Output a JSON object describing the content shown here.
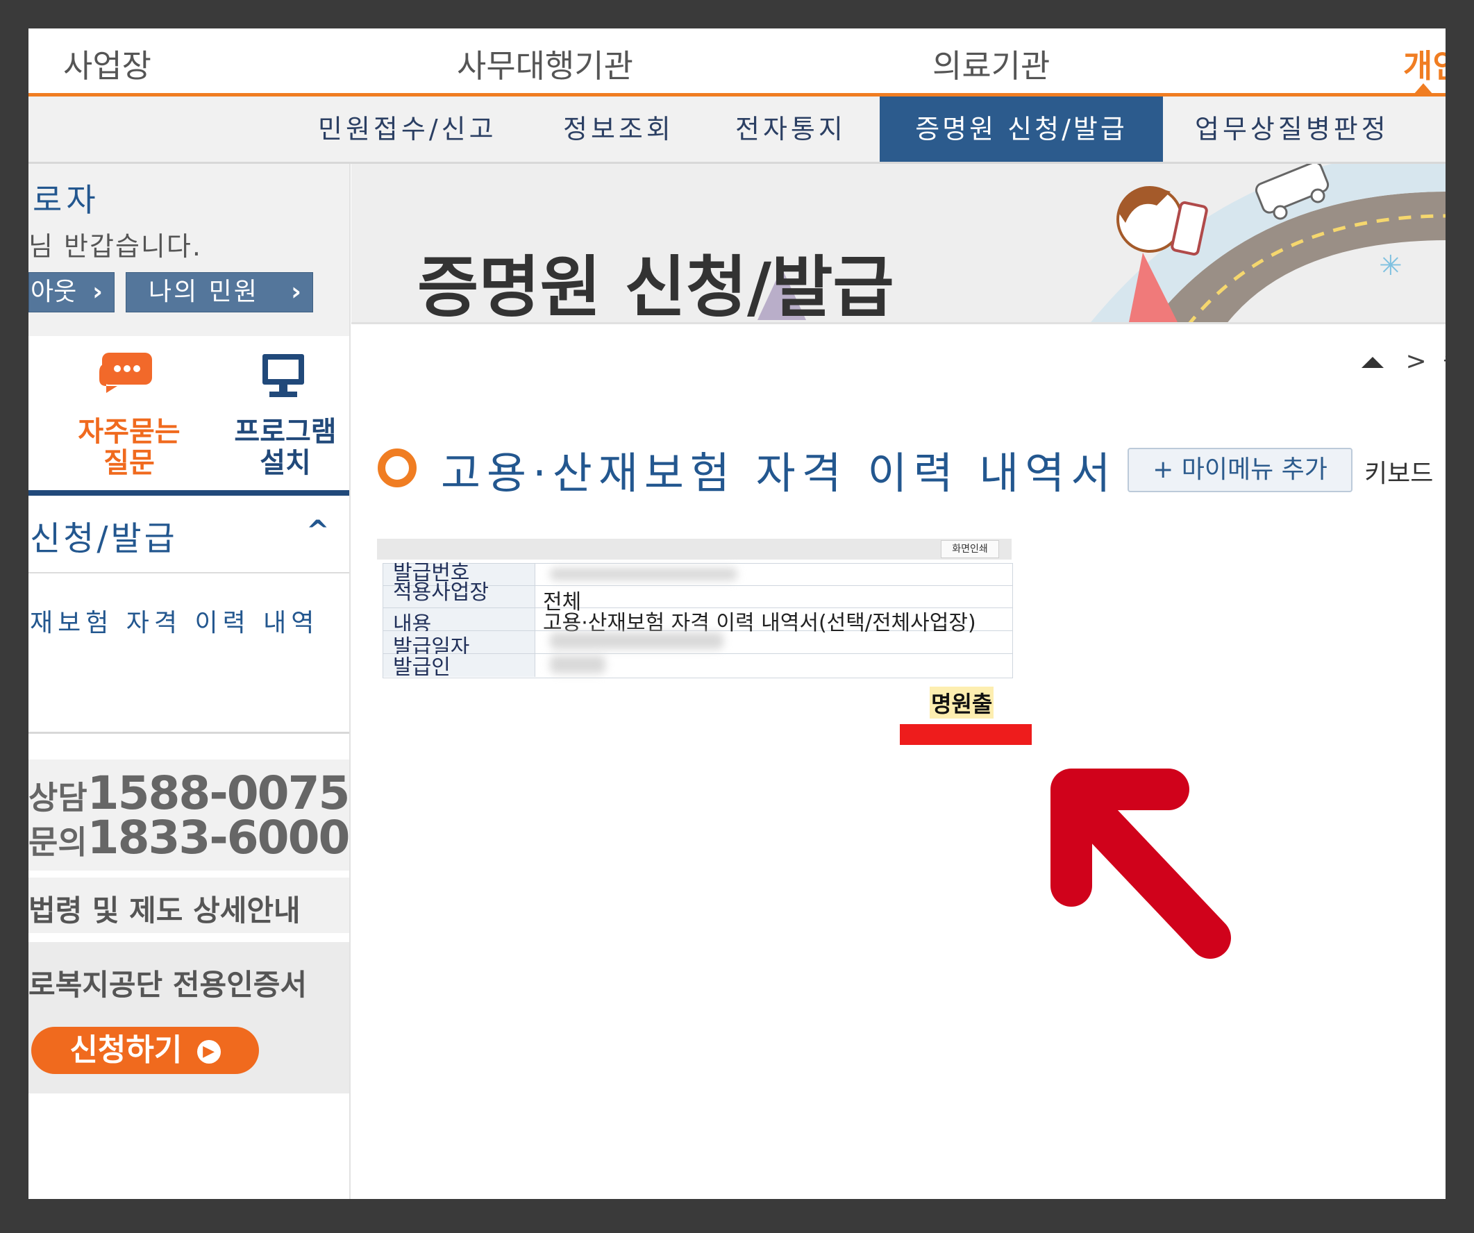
{
  "top_tabs": [
    "사업장",
    "사무대행기관",
    "의료기관",
    "개인"
  ],
  "sub_nav": [
    "민원접수/신고",
    "정보조회",
    "전자통지",
    "증명원 신청/발급",
    "업무상질병판정"
  ],
  "sidebar": {
    "user_label": "로자",
    "greeting": "님 반갑습니다.",
    "logout_button": "아웃",
    "my_civil_button": "나의 민원",
    "faq_label_1": "자주묻는",
    "faq_label_2": "질문",
    "program_label_1": "프로그램",
    "program_label_2": "설치",
    "menu_title": "신청/발급",
    "menu_item": "재보험 자격 이력 내역",
    "tel_line_1_label": "상담",
    "tel_line_1_number": "1588-0075",
    "tel_line_2_label": "문의",
    "tel_line_2_number": "1833-6000",
    "law_text": "법령 및 제도 상세안내",
    "cert_text": "로복지공단 전용인증서",
    "apply_button": "신청하기"
  },
  "banner": {
    "title": "증명원 신청/발급"
  },
  "breadcrumb": {
    "separator": ">",
    "next": "증"
  },
  "page": {
    "heading": "고용·산재보험 자격 이력 내역서",
    "mymenu_button": "+ 마이메뉴 추가",
    "keyboard_text": "키보드"
  },
  "document": {
    "print_button": "화면인쇄",
    "rows": [
      {
        "label": "발급번호",
        "value": ""
      },
      {
        "label": "적용사업장",
        "value": "전체"
      },
      {
        "label": "내용",
        "value": "고용·산재보험 자격 이력 내역서(선택/전체사업장)"
      },
      {
        "label": "발급일자",
        "value": ""
      },
      {
        "label": "발급인",
        "value": ""
      }
    ],
    "issue_label": "명원출"
  },
  "colors": {
    "accent_orange": "#f07d22",
    "nav_blue": "#2c5b8d",
    "heading_blue": "#23578f",
    "arrow_red": "#d0021b",
    "highlight_red": "#ee1c1c"
  }
}
